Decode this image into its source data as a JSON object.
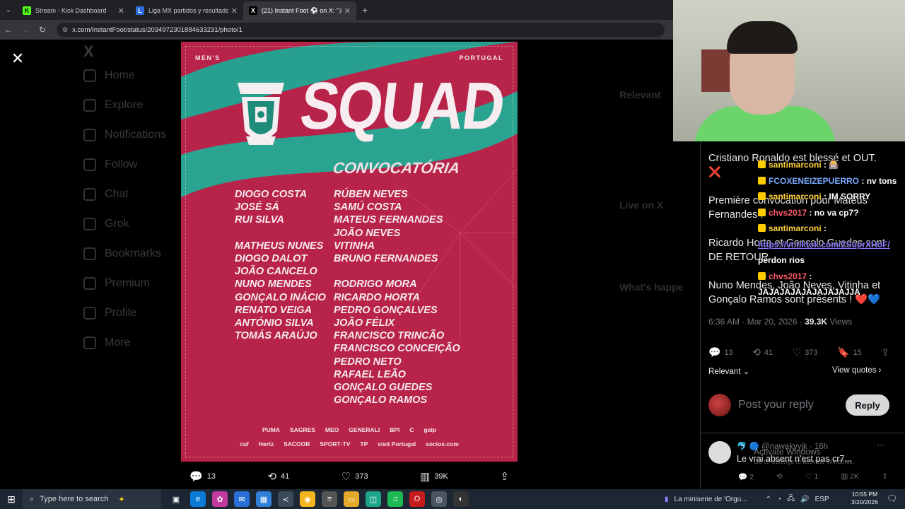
{
  "browser": {
    "tabs": [
      {
        "label": "Stream - Kick Dashboard",
        "fav": "K",
        "fav_color": "#53fc18",
        "active": false
      },
      {
        "label": "Liga MX partidos y resultados 2",
        "fav": "L",
        "fav_color": "#2d6cdf",
        "active": false
      },
      {
        "label": "(21) Instant Foot ⚽ on X: \"🇵",
        "fav": "X",
        "fav_color": "#000000",
        "active": true
      }
    ],
    "url": "x.com/InstantFoot/status/2034972301884633231/photo/1"
  },
  "background_nav": [
    "Home",
    "Explore",
    "Notifications",
    "Follow",
    "Chat",
    "Grok",
    "Bookmarks",
    "Premium",
    "Profile",
    "More"
  ],
  "background_right": [
    "Relevant",
    "Live on X",
    "What's happe"
  ],
  "poster": {
    "corner_left": "MEN'S",
    "corner_right": "PORTUGAL",
    "title": "SQUAD",
    "subtitle": "CONVOCATÓRIA",
    "col1_a": [
      "DIOGO COSTA",
      "JOSÉ SÁ",
      "RUI SILVA"
    ],
    "col1_b": [
      "MATHEUS NUNES",
      "DIOGO DALOT",
      "JOÃO CANCELO",
      "NUNO MENDES",
      "GONÇALO INÁCIO",
      "RENATO VEIGA",
      "ANTÓNIO SILVA",
      "TOMÁS ARAÚJO"
    ],
    "col2_a": [
      "RÚBEN NEVES",
      "SAMÚ COSTA",
      "MATEUS FERNANDES",
      "JOÃO NEVES",
      "VITINHA",
      "BRUNO FERNANDES"
    ],
    "col2_b": [
      "RODRIGO MORA",
      "RICARDO HORTA",
      "PEDRO GONÇALVES",
      "JOÃO FÉLIX",
      "FRANCISCO TRINCÃO",
      "FRANCISCO CONCEIÇÃO",
      "PEDRO NETO",
      "RAFAEL LEÃO",
      "GONÇALO GUEDES",
      "GONÇALO RAMOS"
    ],
    "sponsors_row1": [
      "PUMA",
      "SAGRES",
      "MEO",
      "GENERALI",
      "BPI",
      "C",
      "galp"
    ],
    "sponsors_row2": [
      "cuf",
      "Hertz",
      "SACOOR",
      "SPORT·TV",
      "TP",
      "visit Portugal",
      "socios.com"
    ]
  },
  "photo_actions": {
    "replies": "13",
    "reposts": "41",
    "likes": "373",
    "views": "39K"
  },
  "tweet": {
    "p1": "Cristiano Ronaldo est blessé et OUT.",
    "p1_emoji": "❌",
    "p2": "Première convocation pour Mateus Fernandes !",
    "p3": "Ricardo Horta et Gonçalo Guedes sont DE RETOUR",
    "p4": "Nuno Mendes, João Neves, Vitinha et Gonçalo Ramos sont présents ! ❤️💙",
    "time": "6:36 AM · Mar 20, 2026 · ",
    "views_num": "39.3K",
    "views_label": " Views",
    "stats": {
      "replies": "13",
      "reposts": "41",
      "likes": "373",
      "bookmarks": "15"
    },
    "relevant": "Relevant",
    "view_quotes": "View quotes",
    "reply_placeholder": "Post your reply",
    "reply_button": "Reply"
  },
  "reply2": {
    "header": "🐬 🔵 @nawakyyjk · 16h",
    "text": "Le vrai absent n'est pas cr7...",
    "stats": {
      "replies": "2",
      "reposts": "",
      "likes": "1",
      "views": "2K"
    }
  },
  "watermark": {
    "line1": "Activate Windows",
    "line2": "Go to Settings to activate Windows."
  },
  "chat": [
    {
      "user": "santimarconi",
      "msg": "🎰",
      "cls": "u"
    },
    {
      "user": "FCOXENEIZEPUERRO",
      "msg": "nv tons",
      "cls": "u2"
    },
    {
      "user": "santimarconi",
      "msg": "IM SORRY",
      "cls": "u"
    },
    {
      "user": "chvs2017",
      "msg": "no va cp7?",
      "cls": "u3"
    },
    {
      "user": "santimarconi",
      "msg": "",
      "cls": "u"
    },
    {
      "user": "",
      "msg": "https://vt.tiktok.com/ZSuprXHoF/",
      "cls": "link"
    },
    {
      "user": "",
      "msg": "perdon rios",
      "cls": ""
    },
    {
      "user": "chvs2017",
      "msg": "",
      "cls": "u3"
    },
    {
      "user": "",
      "msg": "JAJAJAJAJAJAJAJAJJA",
      "cls": ""
    }
  ],
  "taskbar": {
    "search_placeholder": "Type here to search",
    "now_playing": "La miniserie de 'Orgu...",
    "lang": "ESP",
    "time": "10:55 PM",
    "date": "3/20/2026"
  }
}
